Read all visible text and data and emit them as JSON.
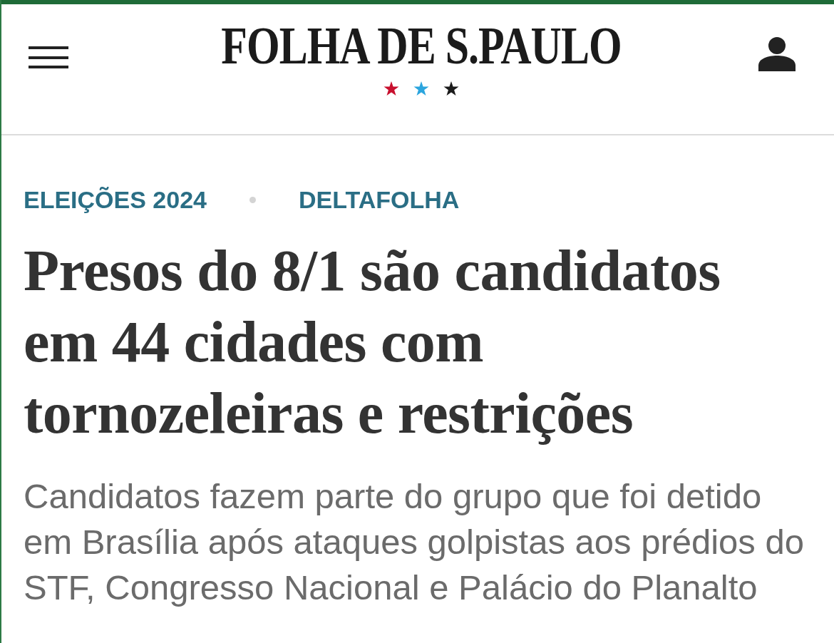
{
  "header": {
    "logo": "FOLHA DE S.PAULO"
  },
  "tags": [
    "ELEIÇÕES 2024",
    "DELTAFOLHA"
  ],
  "headline": "Presos do 8/1 são candidatos em 44 cidades com tornozeleiras e restrições",
  "subhead": "Candidatos fazem parte do grupo que foi detido em Brasília após ataques golpistas aos prédios do STF, Congresso Nacional e Palácio do Planalto"
}
